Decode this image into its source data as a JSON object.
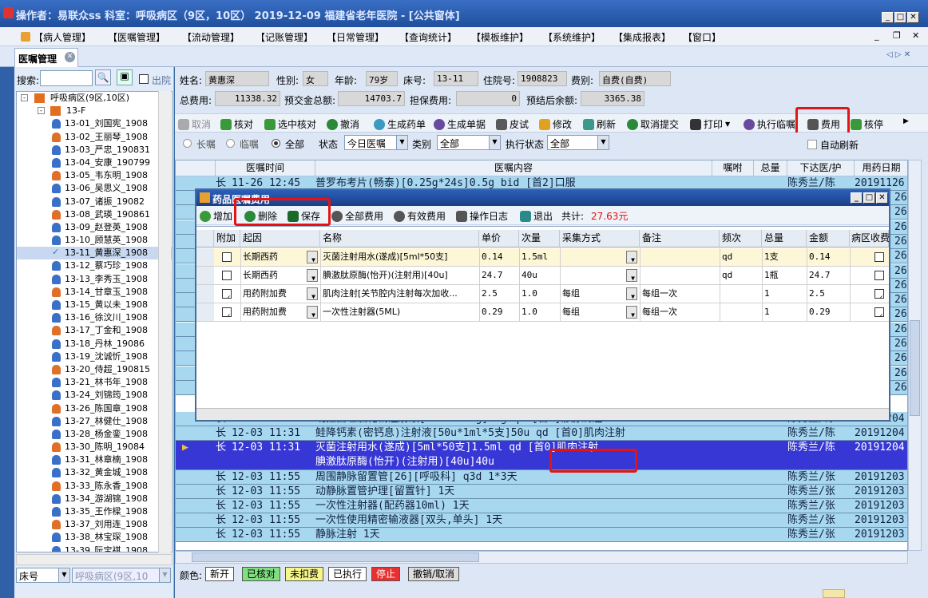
{
  "window": {
    "title": "操作者：易联众ss    科室：呼吸病区（9区，10区）    2019-12-09    福建省老年医院 - [公共窗体]"
  },
  "menu": [
    "【病人管理】",
    "【医嘱管理】",
    "【流动管理】",
    "【记账管理】",
    "【日常管理】",
    "【查询统计】",
    "【模板维护】",
    "【系统维护】",
    "【集成报表】",
    "【窗口】"
  ],
  "tab": {
    "label": "医嘱管理"
  },
  "left": {
    "search_label": "搜索:",
    "discharge_label": "出院",
    "ward": "呼吸病区(9区,10区)",
    "floor": "13-F",
    "patients": [
      "13-01_刘国宪_1908",
      "13-02_王丽琴_1908",
      "13-03_严忠_190831",
      "13-04_安康_190799",
      "13-05_韦东明_1908",
      "13-06_吴思义_1908",
      "13-07_诸振_19082",
      "13-08_武瑛_190861",
      "13-09_赵登英_1908",
      "13-10_顾慧英_1908",
      "13-11_黄惠深_1908",
      "13-12_蔡巧珍_1908",
      "13-13_李秀玉_1908",
      "13-14_甘章玉_1908",
      "13-15_黄以未_1908",
      "13-16_徐汶川_1908",
      "13-17_丁金和_1908",
      "13-18_丹林_19086",
      "13-19_沈诚忻_1908",
      "13-20_侍超_190815",
      "13-21_林书年_1908",
      "13-24_刘锦筠_1908",
      "13-26_陈国章_1908",
      "13-27_林健仕_1908",
      "13-28_杨金銮_1908",
      "13-30_陈明_19084",
      "13-31_林章楠_1908",
      "13-32_黄金城_1908",
      "13-33_陈永香_1908",
      "13-34_游湖锦_1908",
      "13-35_王作樑_1908",
      "13-37_刘用连_1908",
      "13-38_林宝琛_1908",
      "13-39_阮宝祺_1908"
    ],
    "bottom_select": "床号",
    "bottom_ward": "呼吸病区(9区,10"
  },
  "patient": {
    "name_label": "姓名:",
    "name": "黄惠深",
    "sex_label": "性别:",
    "sex": "女",
    "age_label": "年龄:",
    "age": "79岁",
    "bed_label": "床号:",
    "bed": "13-11",
    "inpatient_label": "住院号:",
    "inpatient": "1908823",
    "fee_type_label": "费别:",
    "fee_type": "自费(自费)",
    "total_label": "总费用:",
    "total": "11338.32",
    "deposit_label": "预交金总额:",
    "deposit": "14703.7",
    "guarantee_label": "担保费用:",
    "guarantee": "0",
    "balance_label": "预结后余额:",
    "balance": "3365.38"
  },
  "toolbar": [
    "取消",
    "核对",
    "选中核对",
    "撤消",
    "生成药单",
    "生成单据",
    "皮试",
    "修改",
    "刷新",
    "取消提交",
    "打印",
    "执行临嘱",
    "费用",
    "核停"
  ],
  "filters": {
    "long_term": "长嘱",
    "temporary": "临嘱",
    "all": "全部",
    "status_label": "状态",
    "status_value": "今日医嘱",
    "category_label": "类别",
    "category_value": "全部",
    "exec_label": "执行状态",
    "exec_value": "全部",
    "auto_refresh": "自动刷新"
  },
  "grid": {
    "headers": [
      "医嘱时间",
      "医嘱内容",
      "嘱咐",
      "总量",
      "下达医/护",
      "用药日期"
    ],
    "rows": [
      {
        "type": "长",
        "time": "11-26 12:45",
        "content": "普罗布考片(畅泰)[0.25g*24s]0.5g bid [首2]口服",
        "nurse": "陈秀兰/陈",
        "date": "20191126"
      },
      {
        "type": "长",
        "time": "12-03 11:31",
        "content": "吡拉西坦氯化钠注射液[100ml:20g]20g qd [首0]静脉滴注",
        "nurse": "陈秀兰/陈",
        "date": "20191204"
      },
      {
        "type": "长",
        "time": "12-03 11:31",
        "content": "鲑降钙素(密钙息)注射液[50u*1ml*5支]50u qd [首0]肌肉注射",
        "nurse": "陈秀兰/陈",
        "date": "20191204"
      },
      {
        "type": "长",
        "time": "12-03 11:31",
        "content": "灭菌注射用水(遂成)[5ml*50支]1.5ml qd [首0]肌肉注射",
        "content2": "腆激肽原酶(怡开)(注射用)[40u]40u",
        "nurse": "陈秀兰/陈",
        "date": "20191204",
        "selected": true
      },
      {
        "type": "长",
        "time": "12-03 11:55",
        "content": "周围静脉留置管[26][呼吸科] q3d  1*3天",
        "nurse": "陈秀兰/张",
        "date": "20191203"
      },
      {
        "type": "长",
        "time": "12-03 11:55",
        "content": "动静脉置管护理[留置针]    1天",
        "nurse": "陈秀兰/张",
        "date": "20191203"
      },
      {
        "type": "长",
        "time": "12-03 11:55",
        "content": "一次性注射器(配药器10ml)    1天",
        "nurse": "陈秀兰/张",
        "date": "20191203"
      },
      {
        "type": "长",
        "time": "12-03 11:55",
        "content": "一次性使用精密输液器[双头,单头]    1天",
        "nurse": "陈秀兰/张",
        "date": "20191203"
      },
      {
        "type": "长",
        "time": "12-03 11:55",
        "content": "静脉注射    1天",
        "nurse": "陈秀兰/张",
        "date": "20191203"
      }
    ],
    "side_dates": [
      "26",
      "26",
      "26",
      "26",
      "26",
      "26",
      "26",
      "26",
      "26",
      "26",
      "26",
      "26",
      "26",
      "26"
    ]
  },
  "legend": {
    "label": "颜色:",
    "items": [
      "新开",
      "已核对",
      "未扣费",
      "已执行",
      "停止",
      "撤销/取消"
    ]
  },
  "dialog": {
    "title": "药品医嘱费用",
    "buttons": [
      "增加",
      "删除",
      "保存",
      "全部费用",
      "有效费用",
      "操作日志",
      "退出"
    ],
    "total_label": "共计:",
    "total": "27.63元",
    "headers": [
      "附加",
      "起因",
      "名称",
      "单价",
      "次量",
      "采集方式",
      "备注",
      "频次",
      "总量",
      "金额",
      "病区收费"
    ],
    "rows": [
      {
        "attach": "",
        "reason": "长期西药",
        "name": "灭菌注射用水(遂成)[5ml*50支]",
        "price": "0.14",
        "dose": "1.5ml",
        "method": "",
        "note": "",
        "freq": "qd",
        "qty": "1支",
        "amount": "0.14",
        "ward": ""
      },
      {
        "attach": "",
        "reason": "长期西药",
        "name": "腆激肽原酶(怡开)(注射用)[40u]",
        "price": "24.7",
        "dose": "40u",
        "method": "",
        "note": "",
        "freq": "qd",
        "qty": "1瓶",
        "amount": "24.7",
        "ward": ""
      },
      {
        "attach": "✓",
        "reason": "用药附加费",
        "name": "肌肉注射[关节腔内注射每次加收...",
        "price": "2.5",
        "dose": "1.0",
        "method": "每组",
        "note": "每组一次",
        "freq": "",
        "qty": "1",
        "amount": "2.5",
        "ward": "✓"
      },
      {
        "attach": "✓",
        "reason": "用药附加费",
        "name": "一次性注射器(5ML)",
        "price": "0.29",
        "dose": "1.0",
        "method": "每组",
        "note": "每组一次",
        "freq": "",
        "qty": "1",
        "amount": "0.29",
        "ward": "✓"
      }
    ]
  }
}
